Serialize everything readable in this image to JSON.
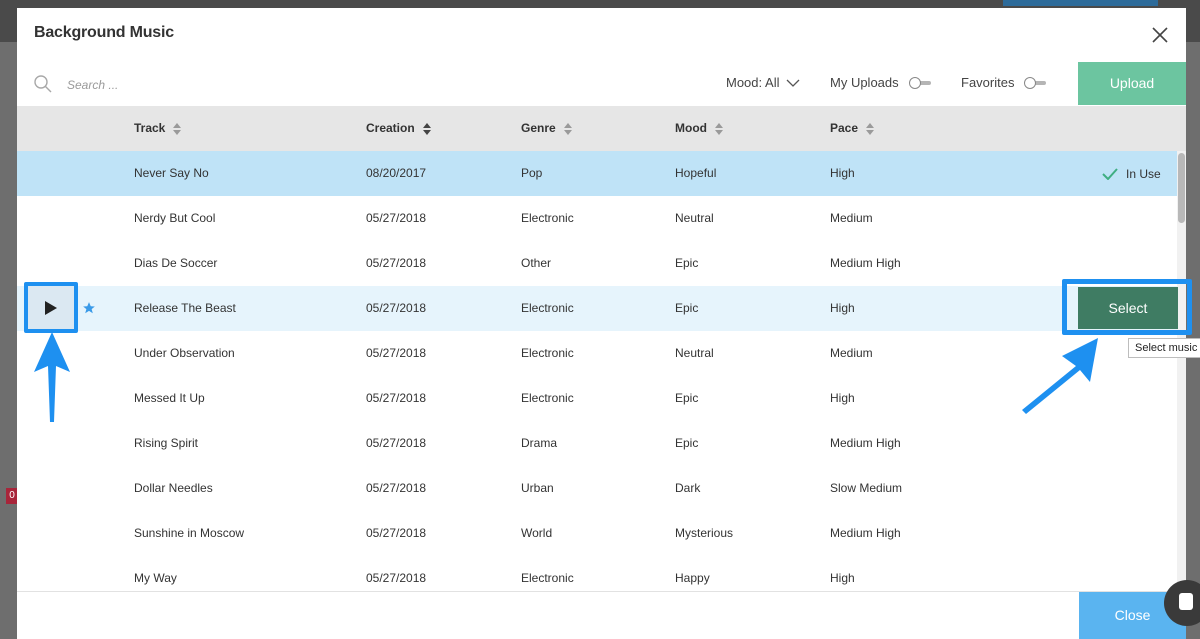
{
  "modal": {
    "title": "Background Music",
    "search_placeholder": "Search ...",
    "mood_filter_label": "Mood: All",
    "my_uploads_label": "My Uploads",
    "favorites_label": "Favorites",
    "upload_label": "Upload",
    "close_label": "Close"
  },
  "table": {
    "columns": [
      "Track",
      "Creation",
      "Genre",
      "Mood",
      "Pace"
    ],
    "rows": [
      {
        "track": "Never Say No",
        "creation": "08/20/2017",
        "genre": "Pop",
        "mood": "Hopeful",
        "pace": "High"
      },
      {
        "track": "Nerdy But Cool",
        "creation": "05/27/2018",
        "genre": "Electronic",
        "mood": "Neutral",
        "pace": "Medium"
      },
      {
        "track": "Dias De Soccer",
        "creation": "05/27/2018",
        "genre": "Other",
        "mood": "Epic",
        "pace": "Medium High"
      },
      {
        "track": "Release The Beast",
        "creation": "05/27/2018",
        "genre": "Electronic",
        "mood": "Epic",
        "pace": "High"
      },
      {
        "track": "Under Observation",
        "creation": "05/27/2018",
        "genre": "Electronic",
        "mood": "Neutral",
        "pace": "Medium"
      },
      {
        "track": "Messed It Up",
        "creation": "05/27/2018",
        "genre": "Electronic",
        "mood": "Epic",
        "pace": "High"
      },
      {
        "track": "Rising Spirit",
        "creation": "05/27/2018",
        "genre": "Drama",
        "mood": "Epic",
        "pace": "Medium High"
      },
      {
        "track": "Dollar Needles",
        "creation": "05/27/2018",
        "genre": "Urban",
        "mood": "Dark",
        "pace": "Slow Medium"
      },
      {
        "track": "Sunshine in Moscow",
        "creation": "05/27/2018",
        "genre": "World",
        "mood": "Mysterious",
        "pace": "Medium High"
      },
      {
        "track": "My Way",
        "creation": "05/27/2018",
        "genre": "Electronic",
        "mood": "Happy",
        "pace": "High"
      }
    ],
    "in_use_label": "In Use",
    "select_label": "Select",
    "select_tooltip": "Select music"
  },
  "background": {
    "tag_text": "0"
  },
  "colors": {
    "upload": "#6cc5a0",
    "select": "#3f7c63",
    "close": "#5ab4f0",
    "in_use_row": "#bfe3f7",
    "highlight": "#1e90f0"
  },
  "icons": [
    "search-icon",
    "chevron-down-icon",
    "close-icon",
    "sort-icon",
    "check-icon",
    "play-icon",
    "star-icon",
    "chat-icon",
    "arrow-pointer-icon"
  ]
}
